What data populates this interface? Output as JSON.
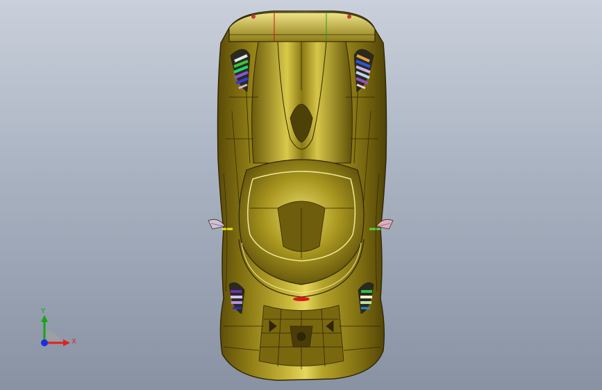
{
  "viewport": {
    "background_top": "#c9d0db",
    "background_bottom": "#8892a3"
  },
  "model": {
    "body_color": "#9c8a1c",
    "body_highlight": "#e5d75e",
    "edge_color": "#2f2606"
  },
  "triad": {
    "x_label": "X",
    "y_label": "Y",
    "x_color": "#e02020",
    "y_color": "#17a417",
    "z_color": "#1d2de0"
  }
}
